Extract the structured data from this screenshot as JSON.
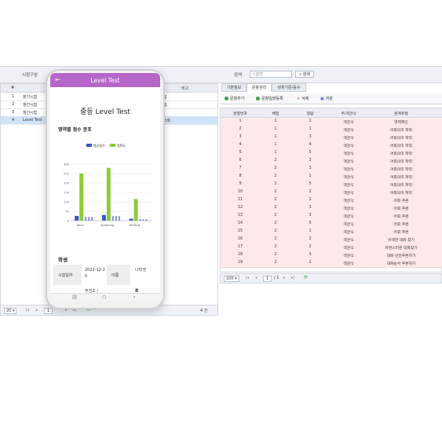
{
  "search_bar": {
    "exam_type_label": "시험구분",
    "search_label": "검색",
    "search_placeholder": "시험명",
    "search_button": "검색"
  },
  "left_grid": {
    "columns": [
      "#",
      "",
      "비고"
    ],
    "rows": [
      {
        "num": "1",
        "name": "분기시험",
        "note": "험"
      },
      {
        "num": "2",
        "name": "월간시험",
        "note": "험"
      },
      {
        "num": "3",
        "name": "월간시험",
        "note": ""
      },
      {
        "num": "4",
        "name": "Level Test",
        "note": "스트"
      }
    ],
    "footer": {
      "page_size": "20",
      "page": "1",
      "total": "4 건"
    }
  },
  "right_tabs": [
    "기본정보",
    "문항관리",
    "성취기준/등수"
  ],
  "toolbar": {
    "add": "문항추가",
    "bulk": "문항일괄등록",
    "delete": "삭제",
    "save": "저장"
  },
  "right_grid": {
    "columns": [
      "문항번호",
      "배점",
      "정답",
      "주/객관식",
      "문제유형"
    ],
    "rows": [
      [
        "1",
        "1",
        "1",
        "객관식",
        "영역확인"
      ],
      [
        "2",
        "1",
        "1",
        "객관식",
        "어휘의미 파악"
      ],
      [
        "3",
        "1",
        "3",
        "객관식",
        "어휘의미 파악"
      ],
      [
        "4",
        "1",
        "4",
        "객관식",
        "어휘의미 파악"
      ],
      [
        "5",
        "1",
        "5",
        "객관식",
        "어휘의미 파악"
      ],
      [
        "6",
        "2",
        "3",
        "객관식",
        "어휘의미 파악"
      ],
      [
        "7",
        "2",
        "3",
        "객관식",
        "어휘의미 파악"
      ],
      [
        "8",
        "2",
        "1",
        "객관식",
        "어휘의미 파악"
      ],
      [
        "9",
        "2",
        "5",
        "객관식",
        "어휘의미 파악"
      ],
      [
        "10",
        "2",
        "2",
        "객관식",
        "어휘의미 파악"
      ],
      [
        "11",
        "2",
        "1",
        "객관식",
        "어휘 추론"
      ],
      [
        "12",
        "2",
        "3",
        "객관식",
        "어휘 추론"
      ],
      [
        "13",
        "2",
        "3",
        "객관식",
        "어휘 추론"
      ],
      [
        "14",
        "2",
        "5",
        "객관식",
        "어휘 추론"
      ],
      [
        "15",
        "2",
        "1",
        "객관식",
        "어휘 추론"
      ],
      [
        "16",
        "2",
        "2",
        "객관식",
        "어색한 대화 찾기"
      ],
      [
        "17",
        "2",
        "2",
        "객관식",
        "자연스러운 대화찾기"
      ],
      [
        "18",
        "2",
        "3",
        "객관식",
        "대화 빈칸추론하기"
      ],
      [
        "19",
        "2",
        "2",
        "객관식",
        "대화순서 추론하기"
      ]
    ],
    "footer": {
      "page_size": "100",
      "page": "1",
      "pages": "/ 1"
    }
  },
  "phone": {
    "app_title": "Level Test",
    "heading": "중등 Level Test",
    "section_title": "영역별 점수 분포",
    "student_section": "학생",
    "exam_date_label": "시험일자",
    "exam_date_value": "2022-12-20",
    "name_label": "이름",
    "name_value": "나학생",
    "school_value": "부천초 /",
    "school_extra": "8"
  },
  "chart_data": {
    "type": "bar",
    "categories": [
      "Voca",
      "Speaking",
      "Writing"
    ],
    "legend": [
      "평균점수",
      "정확도"
    ],
    "ylim": [
      0,
      350
    ],
    "yticks": [
      0,
      50,
      100,
      150,
      200,
      250,
      300
    ],
    "note": "small bar groups per category",
    "series": [
      {
        "values": [
          25,
          30,
          10
        ]
      },
      {
        "values": [
          250,
          280,
          115
        ]
      }
    ]
  },
  "colors": {
    "accent": "#b566c8",
    "bar_blue": "#3657c2",
    "bar_green": "#8ccc3c",
    "row_pink": "#fde9ea"
  }
}
